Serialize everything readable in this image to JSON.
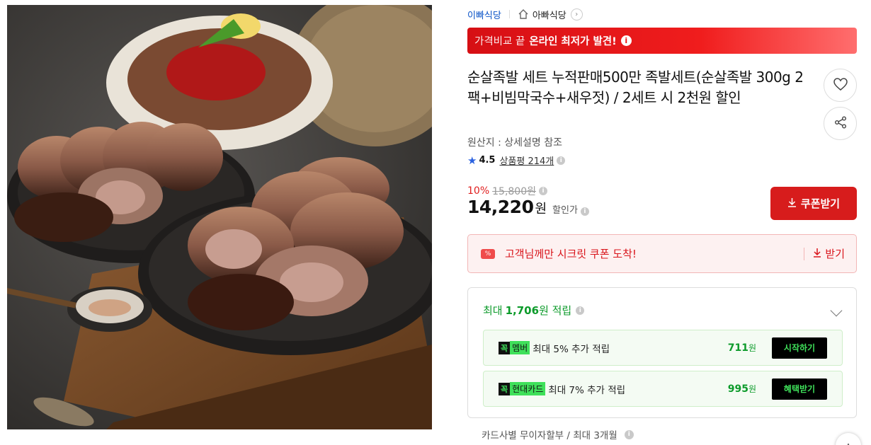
{
  "seller": {
    "link": "이빠식당",
    "store": "아빠식당"
  },
  "promo": {
    "prefix": "가격비교 끝",
    "highlight": "온라인 최저가 발견!"
  },
  "product": {
    "title": "순살족발 세트 누적판매500만 족발세트(순살족발 300g 2팩+비빔막국수+새우젓) / 2세트 시 2천원 할인",
    "origin": "원산지 : 상세설명 참조",
    "rating": "4.5",
    "reviews": "상품평 214개"
  },
  "price": {
    "discount_rate": "10%",
    "original": "15,800원",
    "current": "14,220",
    "unit": "원",
    "label": "할인가"
  },
  "coupon_button": "쿠폰받기",
  "secret_coupon": {
    "tag": "%",
    "message": "고객님께만 시크릿 쿠폰 도착!",
    "receive": "받기"
  },
  "points": {
    "prefix": "최대",
    "amount": "1,706",
    "suffix": "원 적립",
    "offers": [
      {
        "logo_k": "꼭",
        "logo_name": "멤버",
        "text": "최대 5% 추가 적립",
        "amount": "711",
        "unit": "원",
        "button": "시작하기"
      },
      {
        "logo_k": "꼭",
        "logo_name": "현대카드",
        "text": "최대 7% 추가 적립",
        "amount": "995",
        "unit": "원",
        "button": "혜택받기"
      }
    ]
  },
  "installment": "카드사별 무이자할부 / 최대 3개월",
  "colors": {
    "accent_red": "#d71c1c",
    "link_blue": "#0a53c7",
    "point_green": "#0d9b2b",
    "neon_green": "#3fe05a"
  },
  "icons": [
    "home-icon",
    "chevron-right-icon",
    "info-icon",
    "heart-icon",
    "share-icon",
    "star-icon",
    "download-icon",
    "chevron-down-icon",
    "up-arrow-icon"
  ]
}
